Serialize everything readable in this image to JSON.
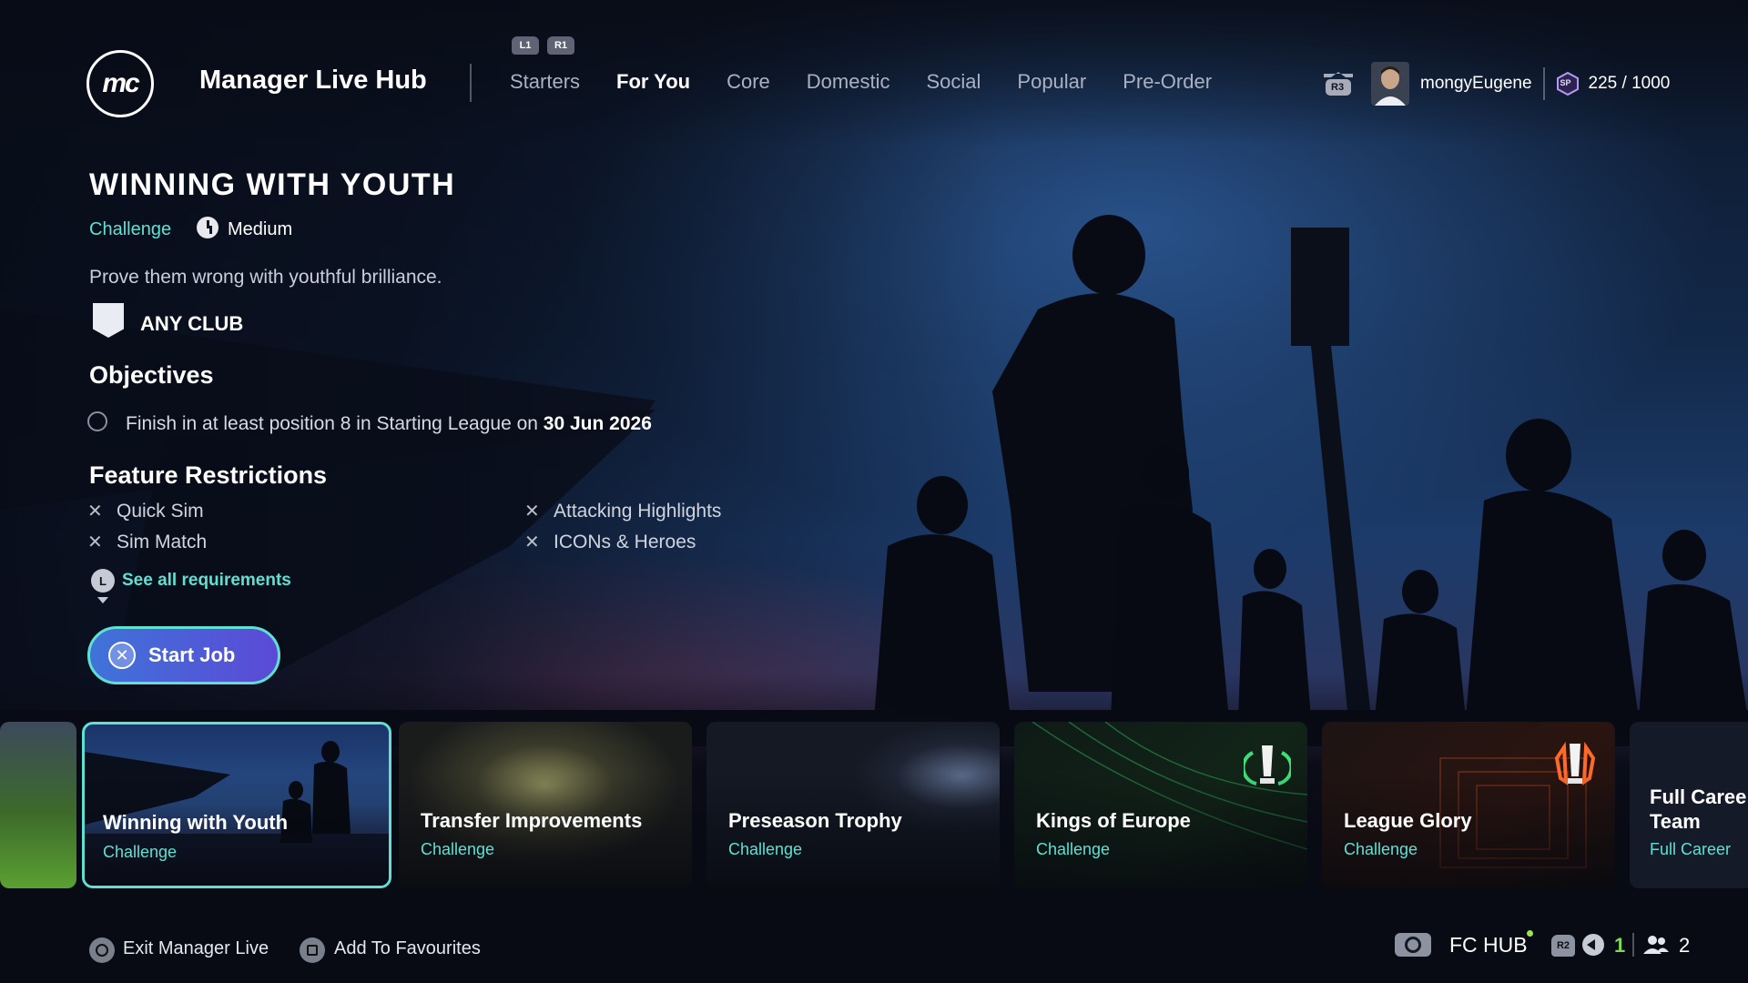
{
  "header": {
    "logo_text": "mc",
    "title": "Manager Live Hub",
    "bumper_left": "L1",
    "bumper_right": "R1",
    "nav_items": [
      "Starters",
      "For You",
      "Core",
      "Domestic",
      "Social",
      "Popular",
      "Pre-Order"
    ],
    "active_nav": "For You",
    "r3_label": "R3",
    "username": "mongyEugene",
    "sp_label": "SP",
    "sp_value": "225 / 1000"
  },
  "job": {
    "title": "WINNING WITH YOUTH",
    "type": "Challenge",
    "difficulty": "Medium",
    "description": "Prove them wrong with youthful brilliance.",
    "club": "ANY CLUB",
    "objectives_heading": "Objectives",
    "objective_prefix": "Finish in at least position 8 in Starting League on ",
    "objective_date": "30 Jun 2026",
    "restrictions_heading": "Feature Restrictions",
    "restrictions": [
      "Quick Sim",
      "Sim Match",
      "Attacking Highlights",
      "ICONs & Heroes"
    ],
    "see_all_button_glyph": "L",
    "see_all": "See all requirements",
    "start_button": "Start Job"
  },
  "carousel": [
    {
      "title": "Winning with Youth",
      "subtitle": "Challenge",
      "selected": true
    },
    {
      "title": "Transfer Improvements",
      "subtitle": "Challenge"
    },
    {
      "title": "Preseason Trophy",
      "subtitle": "Challenge"
    },
    {
      "title": "Kings of Europe",
      "subtitle": "Challenge"
    },
    {
      "title": "League Glory",
      "subtitle": "Challenge"
    },
    {
      "title": "Full Caree",
      "title_line2": "Team",
      "subtitle": "Full Career"
    }
  ],
  "footer": {
    "exit_label": "Exit Manager Live",
    "favourites_label": "Add To Favourites",
    "fc_hub": "FC HUB",
    "r2_label": "R2",
    "chat_count": "1",
    "friends_count": "2"
  },
  "colors": {
    "accent": "#5fe0d3",
    "start_button_from": "#3f73d8",
    "start_button_to": "#5b4ad6",
    "online_green": "#7ed957"
  },
  "icons": [
    "logo-icon",
    "r3-icon",
    "avatar",
    "sp-icon",
    "clock-icon",
    "club-badge-icon",
    "x-icon",
    "cross-icon",
    "circle-icon",
    "square-icon",
    "fc-hub-icon",
    "r2-icon",
    "chat-icon",
    "friends-icon",
    "trophy-icon"
  ]
}
